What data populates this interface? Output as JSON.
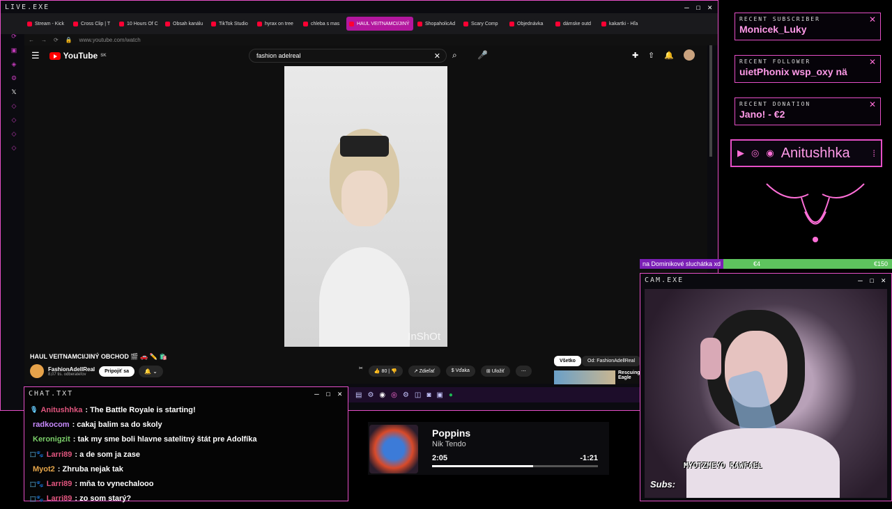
{
  "browser_window": {
    "title": "LIVE.EXE",
    "tabs": [
      {
        "label": "Stream - Kick"
      },
      {
        "label": "Cross Clip | T"
      },
      {
        "label": "10 Hours Of C"
      },
      {
        "label": "Obsah kanálu"
      },
      {
        "label": "TikTok Studio"
      },
      {
        "label": "hyrax on tree"
      },
      {
        "label": "chleba s mas"
      },
      {
        "label": "HAUL VEITNAMCI/JINÝ",
        "active": true
      },
      {
        "label": "ShopaholicAd"
      },
      {
        "label": "Scary Comp"
      },
      {
        "label": "Objednávka"
      },
      {
        "label": "dámske outd"
      },
      {
        "label": "kakartki - Hľa"
      }
    ],
    "url": "www.youtube.com/watch"
  },
  "youtube": {
    "logo_text": "YouTube",
    "logo_sup": "SK",
    "search_value": "fashion adelreal",
    "video_title": "HAUL VEITNAMCI/JINÝ OBCHOD 🎬 🚗 ✏️ 🛍️",
    "watermark": "InShOt",
    "channel_name": "FashionAdellReal",
    "subscribers": "8,07 tis. odberateľov",
    "join_label": "Pripojiť sa",
    "like_count": "80",
    "share_label": "Zdieľať",
    "thanks_label": "Vďaka",
    "save_label": "Uložiť",
    "chip_all": "Všetko",
    "chip_from": "Od: FashionAdellReal",
    "suggested_title": "Rescuing Eagle"
  },
  "alerts": [
    {
      "heading": "RECENT SUBSCRIBER",
      "value": "Monicek_Luky"
    },
    {
      "heading": "RECENT FOLLOWER",
      "value": "uietPhonix   wsp_oxy   nä"
    },
    {
      "heading": "RECENT DONATION",
      "value": "Jano! - €2"
    }
  ],
  "social": {
    "name": "Anitushhka",
    "icons": [
      "youtube-icon",
      "instagram-icon",
      "discord-icon"
    ]
  },
  "donation_goal": {
    "text": "na Dominikové sluchátka xd",
    "current": "€4",
    "goal": "€150",
    "progress": 0.03
  },
  "cam_window": {
    "title": "CAM.EXE",
    "subs_label": "Subs:",
    "overlay_name": "MYOTZMEYO RAWFAEL"
  },
  "chat_window": {
    "title": "CHAT.TXT",
    "messages": [
      {
        "user": "Anitushhka",
        "user_color": "#e0557e",
        "text": ": The Battle Royale is starting!",
        "badge": "🎙"
      },
      {
        "user": "radkocom",
        "user_color": "#c88aff",
        "text": ": cakaj balim sa do skoly",
        "badge": ""
      },
      {
        "user": "Keronigzit",
        "user_color": "#7cd06a",
        "text": ": tak my sme boli hlavne satelitný štát pre Adolfíka",
        "badge": ""
      },
      {
        "user": "Larri89",
        "user_color": "#e0557e",
        "text": ": a de som ja zase",
        "badge": "⬚🐾"
      },
      {
        "user": "Myot2",
        "user_color": "#e8a74a",
        "text": ": Zhruba nejak tak",
        "badge": ""
      },
      {
        "user": "Larri89",
        "user_color": "#e0557e",
        "text": ": mňa to vynechalooo",
        "badge": "⬚🐾"
      },
      {
        "user": "Larri89",
        "user_color": "#e0557e",
        "text": ": zo   som starý?",
        "badge": "⬚🐾"
      }
    ]
  },
  "music": {
    "song": "Poppins",
    "artist": "Nik Tendo",
    "elapsed": "2:05",
    "remaining": "-1:21",
    "progress": 0.61
  }
}
